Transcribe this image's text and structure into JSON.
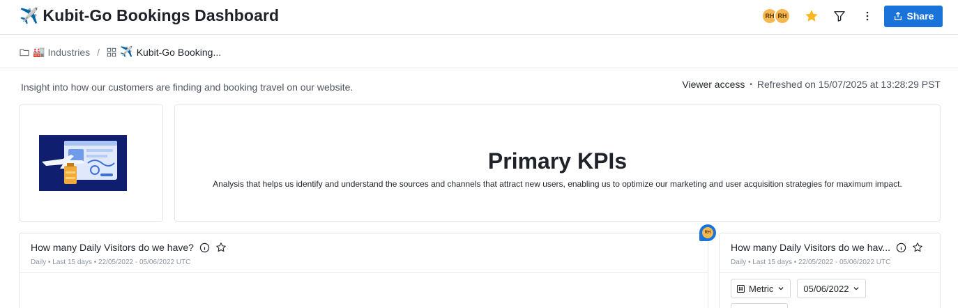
{
  "header": {
    "title_emoji": "✈️",
    "title": "Kubit-Go Bookings Dashboard",
    "avatars": [
      "RH",
      "RH"
    ],
    "share_label": "Share",
    "icons": [
      "star-icon",
      "filter-icon",
      "more-vertical-icon",
      "share-icon"
    ],
    "accent_color": "#1a73d9",
    "star_color": "#f5b820"
  },
  "breadcrumb": {
    "items": [
      {
        "icon": "folder-icon",
        "emoji": "🏭",
        "label": "Industries"
      },
      {
        "icon": "dashboard-icon",
        "emoji": "✈️",
        "label": "Kubit-Go Booking..."
      }
    ],
    "separator": "/"
  },
  "description": "Insight into how our customers are finding and booking travel on our website.",
  "meta": {
    "access": "Viewer access",
    "separator": "•",
    "refreshed": "Refreshed on 15/07/2025 at 13:28:29 PST"
  },
  "kpi": {
    "title": "Primary KPIs",
    "text": "Analysis that helps us identify and understand the sources and channels that attract new users, enabling us to optimize our marketing and user acquisition strategies for maximum impact."
  },
  "cards": [
    {
      "title": "How many Daily Visitors do we have?",
      "subtitle": "Daily • Last 15 days • 22/05/2022 - 05/06/2022 UTC"
    },
    {
      "title": "How many Daily Visitors do we hav...",
      "subtitle": "Daily • Last 15 days • 22/05/2022 - 05/06/2022 UTC",
      "controls": {
        "metric": "Metric",
        "date": "05/06/2022"
      }
    }
  ],
  "comment_avatar": "RH"
}
